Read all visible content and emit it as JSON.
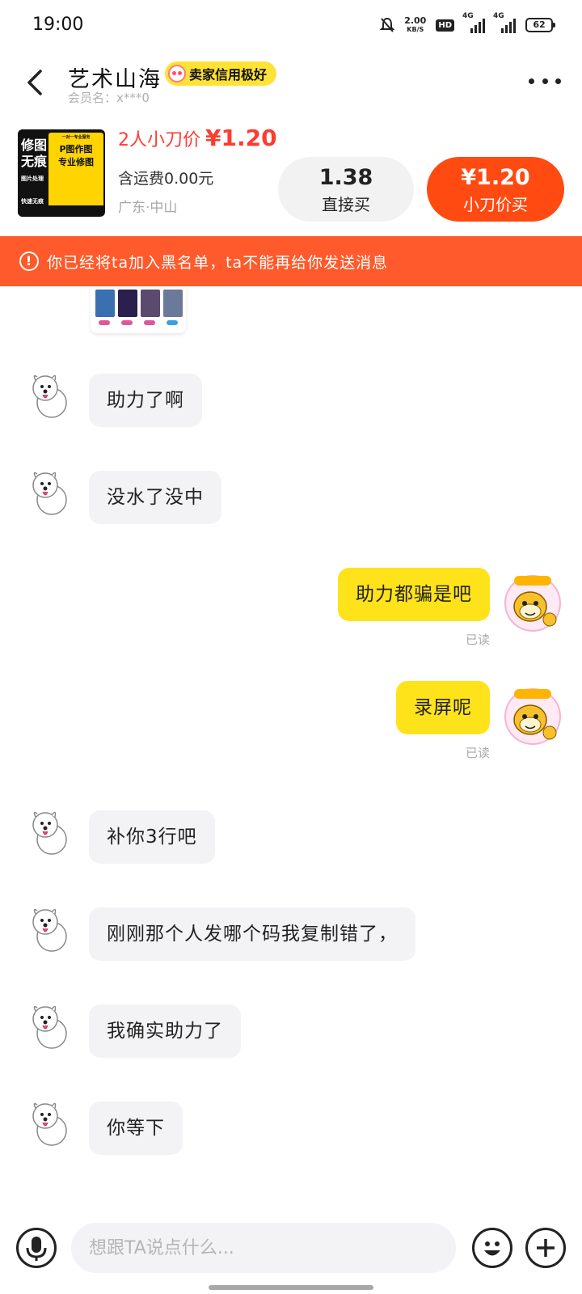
{
  "status_bar": {
    "time": "19:00",
    "net_speed_value": "2.00",
    "net_speed_unit": "KB/S",
    "hd_label": "HD",
    "signal_1_label": "4G",
    "signal_2_label": "4G",
    "battery": "62"
  },
  "header": {
    "seller_name": "艺术山海",
    "credit_badge": "卖家信用极好",
    "member_label": "会员名：x***0"
  },
  "product": {
    "thumb_text": {
      "left_1": "修图",
      "left_2": "无痕",
      "left_3": "图片处理",
      "left_4": "快速无痕",
      "right_1": "一对一专业服务",
      "right_2": "P图作图",
      "right_3": "专业修图"
    },
    "cut_title": "2人小刀价",
    "cut_price": "¥1.20",
    "shipping": "含运费0.00元",
    "location": "广东·中山",
    "direct_price": "1.38",
    "direct_label": "直接买",
    "cut_button_price": "¥1.20",
    "cut_button_label": "小刀价买"
  },
  "banner": {
    "text": "你已经将ta加入黑名单，ta不能再给你发送消息"
  },
  "messages": [
    {
      "side": "left",
      "text": "助力了啊"
    },
    {
      "side": "left",
      "text": "没水了没中"
    },
    {
      "side": "right",
      "text": "助力都骗是吧",
      "status": "已读"
    },
    {
      "side": "right",
      "text": "录屏呢",
      "status": "已读"
    },
    {
      "side": "left",
      "text": "补你3行吧"
    },
    {
      "side": "left",
      "text": "刚刚那个人发哪个码我复制错了，"
    },
    {
      "side": "left",
      "text": "我确实助力了"
    },
    {
      "side": "left",
      "text": "你等下"
    }
  ],
  "input": {
    "placeholder": "想跟TA说点什么..."
  },
  "colors": {
    "accent_orange": "#ff4a12",
    "banner_orange": "#ff5a2b",
    "price_red": "#ff3b30",
    "bubble_yellow": "#ffe31a",
    "bubble_gray": "#f3f3f5"
  },
  "icons": [
    "back-arrow-icon",
    "more-icon",
    "warning-icon",
    "microphone-icon",
    "emoji-icon",
    "plus-icon"
  ]
}
